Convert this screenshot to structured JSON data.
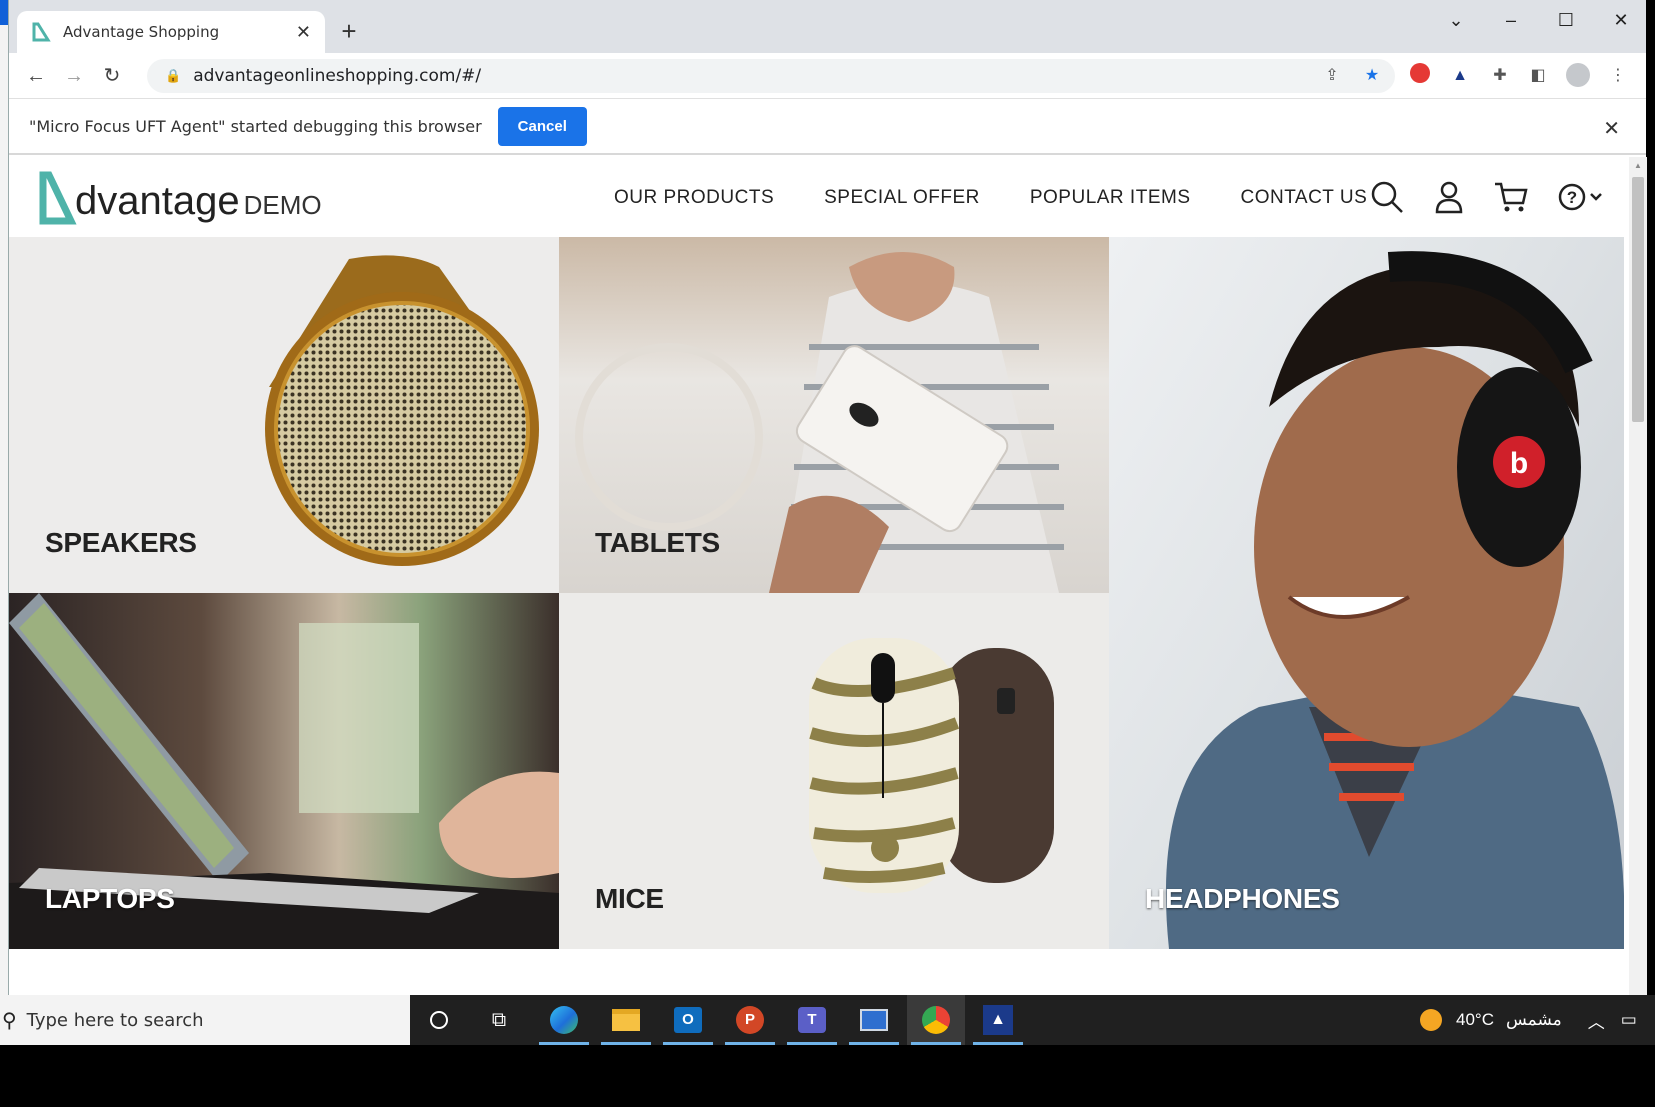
{
  "browser": {
    "tab_title": "Advantage Shopping",
    "url": "advantageonlineshopping.com/#/",
    "infobar_message": "\"Micro Focus UFT Agent\" started debugging this browser",
    "infobar_button": "Cancel"
  },
  "site": {
    "logo_mark": "◣",
    "logo_word": "dvantage",
    "logo_demo": "DEMO",
    "nav": [
      "OUR PRODUCTS",
      "SPECIAL OFFER",
      "POPULAR ITEMS",
      "CONTACT US"
    ],
    "categories": {
      "speakers": "SPEAKERS",
      "tablets": "TABLETS",
      "headphones": "HEADPHONES",
      "laptops": "LAPTOPS",
      "mice": "MICE"
    }
  },
  "taskbar": {
    "search_placeholder": "Type here to search",
    "temperature": "40°C",
    "weather": "مشمس"
  },
  "colors": {
    "brand_teal": "#4fb3a9",
    "infobar_button": "#1a73e8"
  }
}
